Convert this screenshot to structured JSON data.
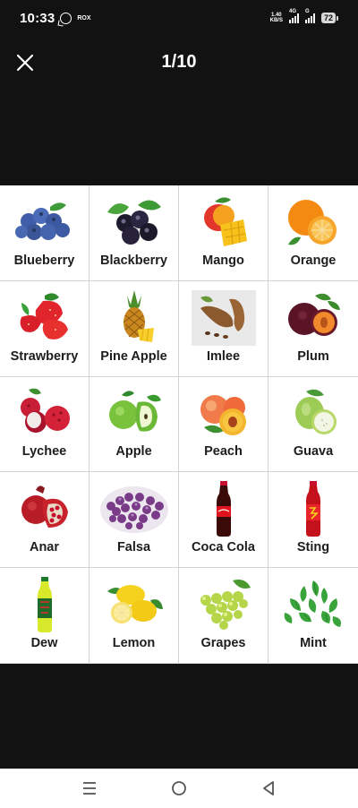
{
  "status_bar": {
    "time": "10:33",
    "carrier_badge": "ROX",
    "net_speed_top": "1.40",
    "net_speed_bottom": "KB/S",
    "net_type_1": "4G",
    "net_type_2": "G",
    "battery": "72"
  },
  "header": {
    "page_counter": "1/10",
    "close_icon": "close-icon"
  },
  "items": [
    {
      "label": "Blueberry",
      "icon": "blueberry"
    },
    {
      "label": "Blackberry",
      "icon": "blackberry"
    },
    {
      "label": "Mango",
      "icon": "mango"
    },
    {
      "label": "Orange",
      "icon": "orange"
    },
    {
      "label": "Strawberry",
      "icon": "strawberry"
    },
    {
      "label": "Pine Apple",
      "icon": "pineapple"
    },
    {
      "label": "Imlee",
      "icon": "tamarind"
    },
    {
      "label": "Plum",
      "icon": "plum"
    },
    {
      "label": "Lychee",
      "icon": "lychee"
    },
    {
      "label": "Apple",
      "icon": "apple"
    },
    {
      "label": "Peach",
      "icon": "peach"
    },
    {
      "label": "Guava",
      "icon": "guava"
    },
    {
      "label": "Anar",
      "icon": "pomegranate"
    },
    {
      "label": "Falsa",
      "icon": "falsa"
    },
    {
      "label": "Coca Cola",
      "icon": "cola-bottle"
    },
    {
      "label": "Sting",
      "icon": "sting-bottle"
    },
    {
      "label": "Dew",
      "icon": "dew-bottle"
    },
    {
      "label": "Lemon",
      "icon": "lemon"
    },
    {
      "label": "Grapes",
      "icon": "grapes"
    },
    {
      "label": "Mint",
      "icon": "mint"
    }
  ],
  "nav": {
    "menu_icon": "menu-icon",
    "home_icon": "home-circle-icon",
    "back_icon": "back-triangle-icon"
  }
}
